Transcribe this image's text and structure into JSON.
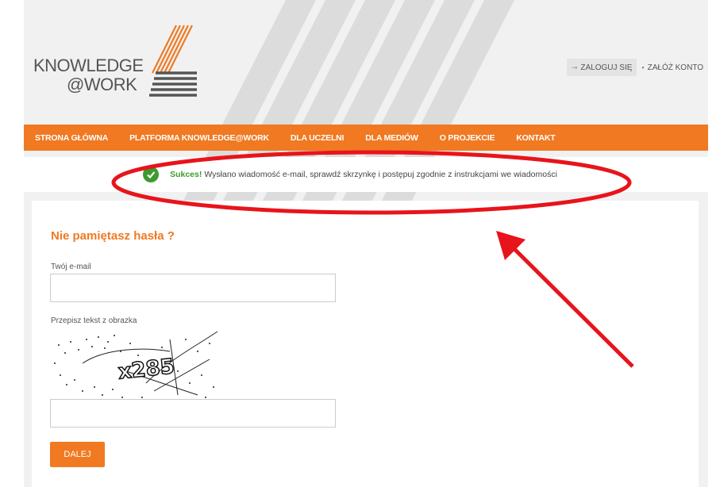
{
  "logo": {
    "line1": "KNOWLEDGE",
    "line2": "@WORK"
  },
  "top_links": {
    "login": "ZALOGUJ SIĘ",
    "register": "ZAŁÓŻ KONTO"
  },
  "nav": {
    "items": [
      {
        "label": "STRONA GŁÓWNA"
      },
      {
        "label": "PLATFORMA KNOWLEDGE@WORK"
      },
      {
        "label": "DLA UCZELNI"
      },
      {
        "label": "DLA MEDIÓW"
      },
      {
        "label": "O PROJEKCIE"
      },
      {
        "label": "KONTAKT"
      }
    ]
  },
  "alert": {
    "strong": "Sukces!",
    "message": "Wysłano wiadomość e-mail, sprawdź skrzynkę i postępuj zgodnie z instrukcjami we wiadomości"
  },
  "form": {
    "title": "Nie pamiętasz hasła ?",
    "email_label": "Twój e-mail",
    "email_value": "",
    "captcha_label": "Przepisz tekst z obrazka",
    "captcha_text": "x285",
    "captcha_value": "",
    "submit_label": "DALEJ"
  },
  "colors": {
    "accent": "#f07922",
    "success": "#3c9b2f",
    "annotation": "#e8141b"
  }
}
